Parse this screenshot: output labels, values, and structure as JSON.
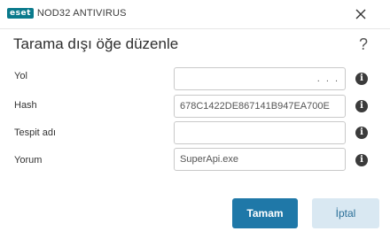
{
  "window": {
    "logo_text": "eset",
    "app_name": "NOD32 ANTIVIRUS",
    "close_icon": "close-icon"
  },
  "dialog": {
    "title": "Tarama dışı öğe düzenle",
    "help_label": "?"
  },
  "form": {
    "path": {
      "label": "Yol",
      "value": "",
      "browse_label": ". . ."
    },
    "hash": {
      "label": "Hash",
      "value": "678C1422DE867141B947EA700E"
    },
    "detection": {
      "label": "Tespit adı",
      "value": ""
    },
    "comment": {
      "label": "Yorum",
      "value": "SuperApi.exe"
    },
    "info_glyph": "i"
  },
  "buttons": {
    "ok": "Tamam",
    "cancel": "İptal"
  },
  "colors": {
    "brand": "#0a7a8c",
    "primary": "#1f78a8",
    "secondary_bg": "#d9e8f2"
  }
}
